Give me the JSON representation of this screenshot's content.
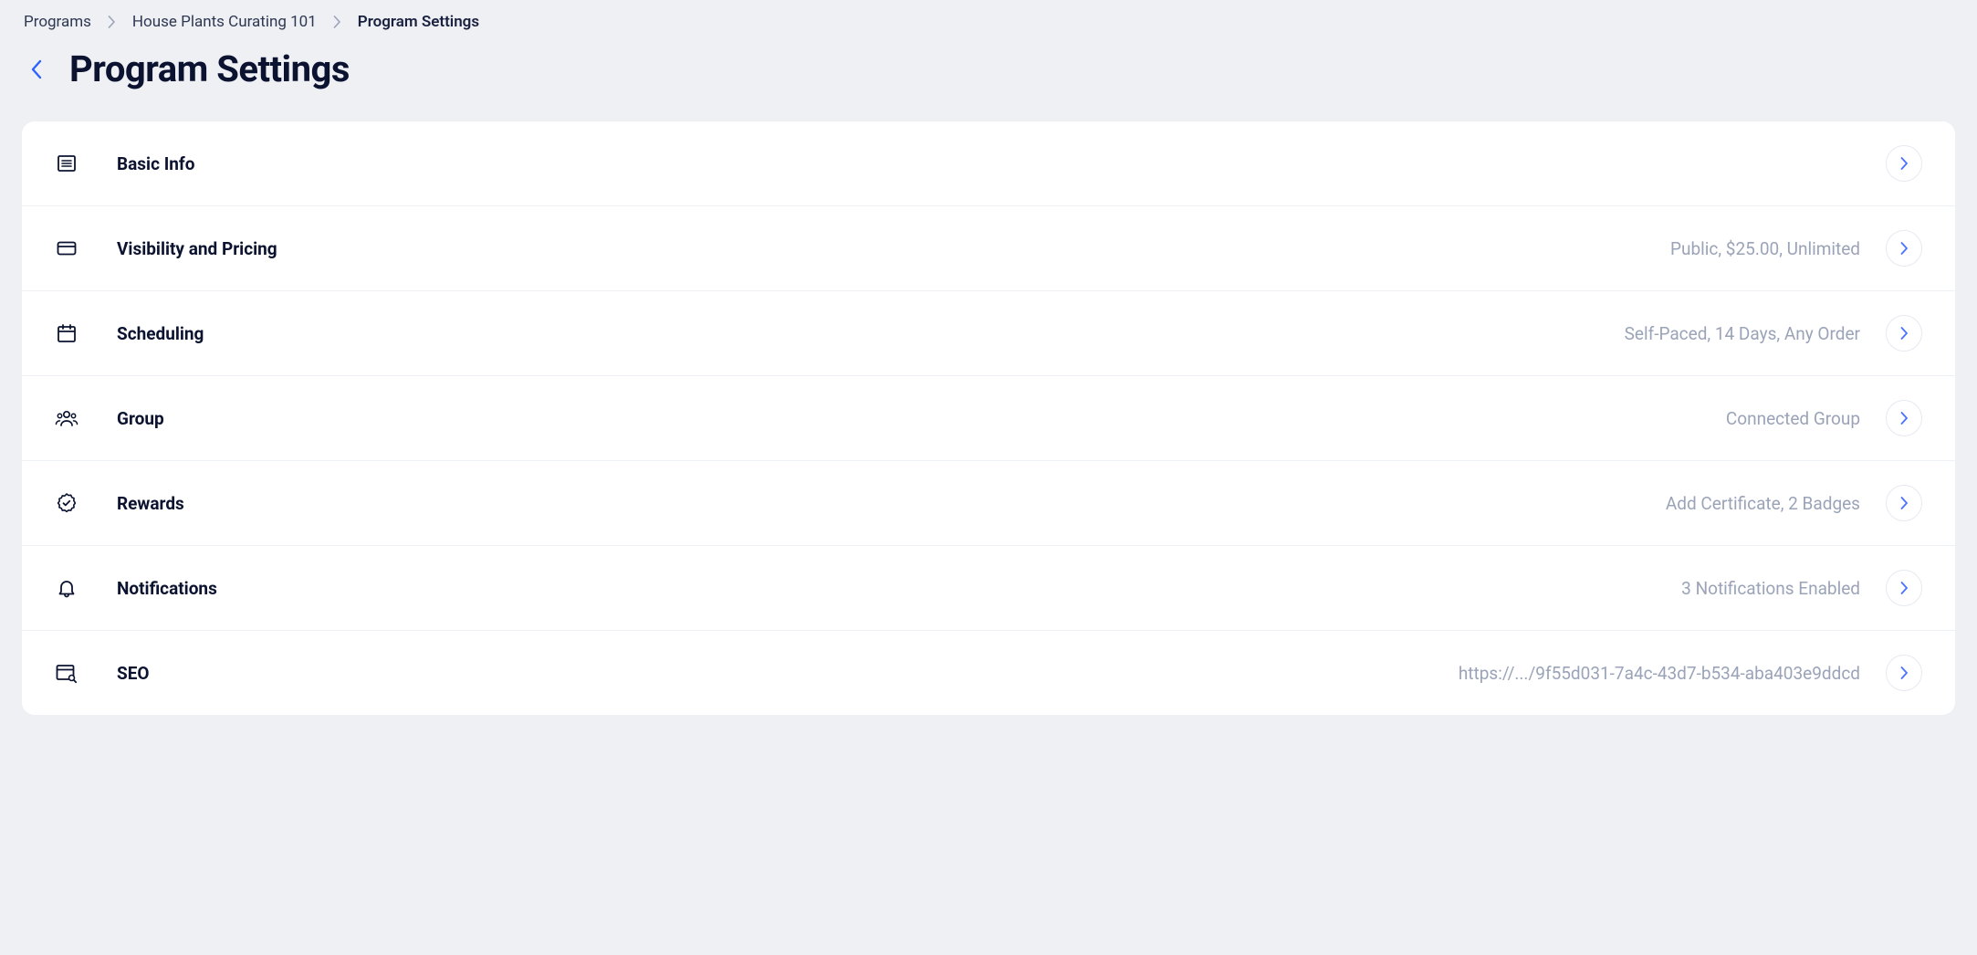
{
  "breadcrumb": {
    "items": [
      {
        "label": "Programs"
      },
      {
        "label": "House Plants Curating 101"
      },
      {
        "label": "Program Settings"
      }
    ]
  },
  "header": {
    "title": "Program Settings"
  },
  "sections": {
    "basic_info": {
      "title": "Basic Info",
      "summary": ""
    },
    "visibility": {
      "title": "Visibility and Pricing",
      "summary": "Public, $25.00, Unlimited"
    },
    "scheduling": {
      "title": "Scheduling",
      "summary": "Self-Paced, 14 Days, Any Order"
    },
    "group": {
      "title": "Group",
      "summary": "Connected Group"
    },
    "rewards": {
      "title": "Rewards",
      "summary": "Add Certificate, 2 Badges"
    },
    "notifications": {
      "title": "Notifications",
      "summary": "3 Notifications Enabled"
    },
    "seo": {
      "title": "SEO",
      "summary": "https://.../9f55d031-7a4c-43d7-b534-aba403e9ddcd"
    }
  }
}
